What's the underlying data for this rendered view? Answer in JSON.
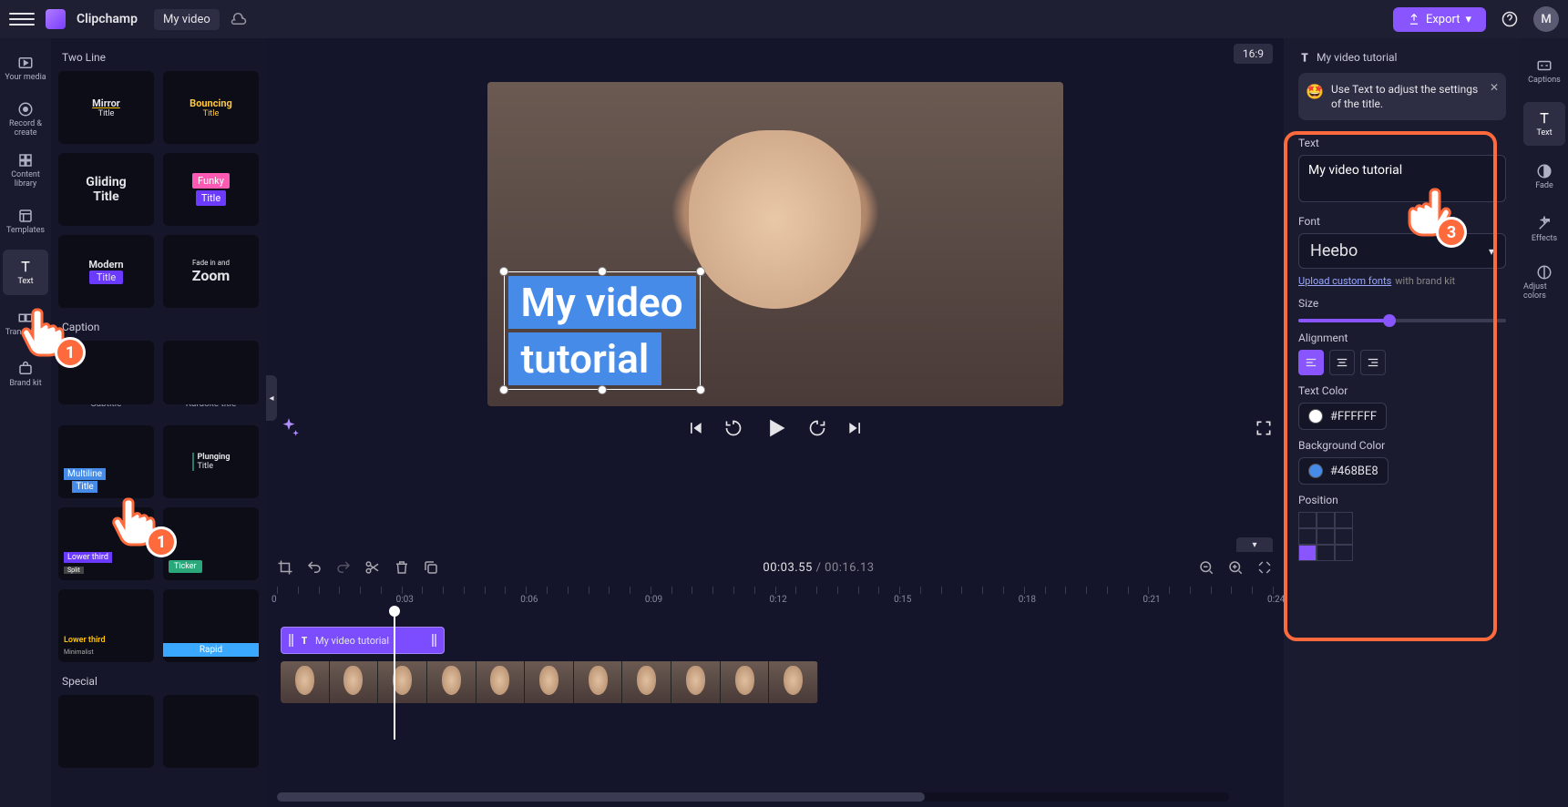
{
  "topbar": {
    "brand": "Clipchamp",
    "project_name": "My video",
    "export_label": "Export",
    "avatar_initial": "M"
  },
  "left_rail": [
    {
      "id": "your-media",
      "label": "Your media"
    },
    {
      "id": "record",
      "label": "Record & create"
    },
    {
      "id": "library",
      "label": "Content library"
    },
    {
      "id": "templates",
      "label": "Templates"
    },
    {
      "id": "text",
      "label": "Text"
    },
    {
      "id": "transitions",
      "label": "Transitions"
    },
    {
      "id": "brand-kit",
      "label": "Brand kit"
    }
  ],
  "text_templates": {
    "section_two_line": "Two Line",
    "two_line": [
      {
        "name": "Mirror",
        "sub": "Title"
      },
      {
        "name": "Bouncing",
        "sub": "Title"
      },
      {
        "name": "Gliding",
        "sub": "Title"
      },
      {
        "name": "Funky",
        "sub": "Title"
      },
      {
        "name": "Modern",
        "sub": "Title"
      },
      {
        "name": "Fade in and",
        "sub": "Zoom"
      }
    ],
    "section_caption": "Caption",
    "caption": [
      {
        "caption": "Subtitle"
      },
      {
        "caption": "Karaoke title"
      },
      {
        "name": "Multiline",
        "sub": "Title"
      },
      {
        "name": "Plunging",
        "sub": "Title"
      },
      {
        "name": "Lower third",
        "sub": "Split"
      },
      {
        "name": "Ticker"
      },
      {
        "name": "Lower third",
        "sub": "Minimalist"
      },
      {
        "name": "Rapid"
      }
    ],
    "section_special": "Special"
  },
  "stage": {
    "aspect": "16:9",
    "title_line1": "My video",
    "title_line2": "tutorial"
  },
  "timeline": {
    "current": "00:03.55",
    "duration": "00:16.13",
    "clip_text_label": "My video tutorial",
    "ruler_marks": [
      "0",
      "0:03",
      "0:06",
      "0:09",
      "0:12",
      "0:15",
      "0:18",
      "0:21",
      "0:24"
    ]
  },
  "props": {
    "crumb": "My video tutorial",
    "tip": "Use Text to adjust the settings of the title.",
    "text_label": "Text",
    "text_value": "My video tutorial",
    "font_label": "Font",
    "font_value": "Heebo",
    "upload_link": "Upload custom fonts",
    "upload_hint": "with brand kit",
    "size_label": "Size",
    "size_pct": 44,
    "alignment_label": "Alignment",
    "text_color_label": "Text Color",
    "text_color_value": "#FFFFFF",
    "bg_color_label": "Background Color",
    "bg_color_value": "#468BE8",
    "position_label": "Position"
  },
  "right_rail": [
    {
      "id": "captions",
      "label": "Captions"
    },
    {
      "id": "text",
      "label": "Text"
    },
    {
      "id": "fade",
      "label": "Fade"
    },
    {
      "id": "effects",
      "label": "Effects"
    },
    {
      "id": "adjust",
      "label": "Adjust colors"
    }
  ],
  "annotations": {
    "badge1": "1",
    "badge3": "3"
  }
}
